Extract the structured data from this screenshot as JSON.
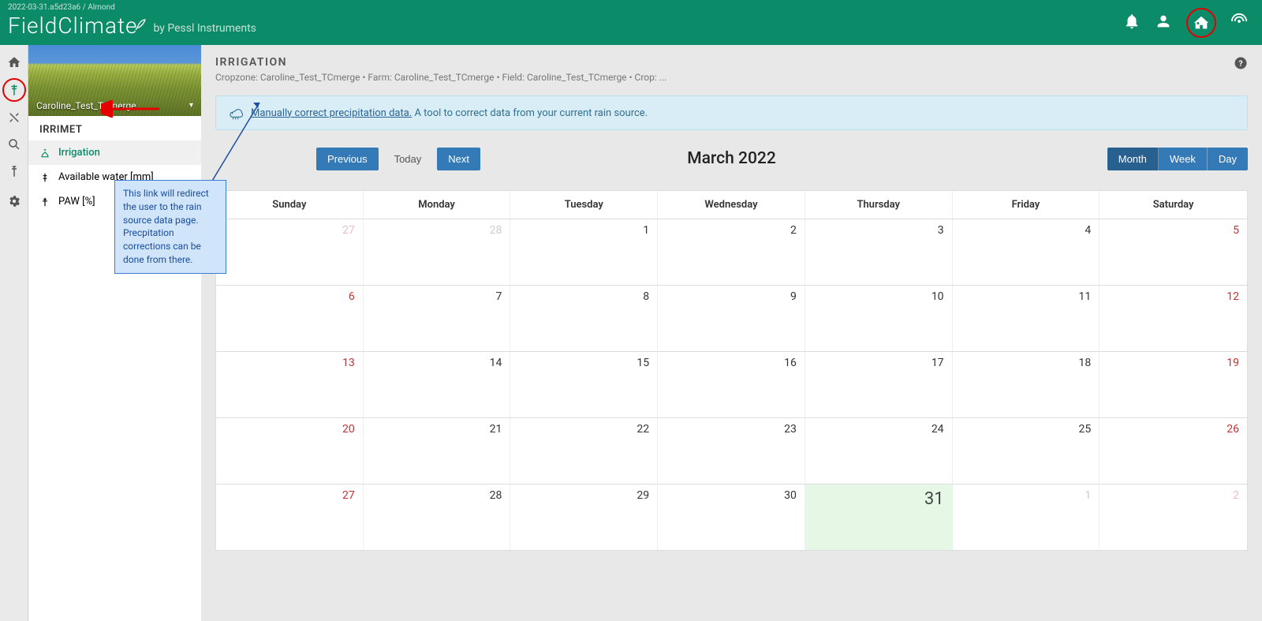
{
  "header": {
    "version": "2022-03-31.a5d23a6 / Almond",
    "logo": "FieldClimate",
    "tagline": "by Pessl Instruments"
  },
  "sidebar": {
    "field_name": "Caroline_Test_TCmerge",
    "section_title": "IRRIMET",
    "items": [
      {
        "label": "Irrigation",
        "icon": "irrigation",
        "active": true
      },
      {
        "label": "Available water [mm]",
        "icon": "water-mm",
        "active": false
      },
      {
        "label": "PAW [%]",
        "icon": "paw",
        "active": false
      }
    ]
  },
  "page": {
    "title": "IRRIGATION",
    "breadcrumb": "Cropzone: Caroline_Test_TCmerge • Farm: Caroline_Test_TCmerge • Field: Caroline_Test_TCmerge • Crop: ..."
  },
  "banner": {
    "link_text": "Manually correct precipitation data.",
    "text": " A tool to correct data from your current rain source."
  },
  "calendar": {
    "nav": {
      "prev": "Previous",
      "today": "Today",
      "next": "Next"
    },
    "views": {
      "month": "Month",
      "week": "Week",
      "day": "Day"
    },
    "title": "March 2022",
    "days": [
      "Sunday",
      "Monday",
      "Tuesday",
      "Wednesday",
      "Thursday",
      "Friday",
      "Saturday"
    ],
    "cells": [
      {
        "n": 27,
        "other": true,
        "we": true
      },
      {
        "n": 28,
        "other": true
      },
      {
        "n": 1
      },
      {
        "n": 2
      },
      {
        "n": 3
      },
      {
        "n": 4
      },
      {
        "n": 5,
        "we": true
      },
      {
        "n": 6,
        "we": true
      },
      {
        "n": 7
      },
      {
        "n": 8
      },
      {
        "n": 9
      },
      {
        "n": 10
      },
      {
        "n": 11
      },
      {
        "n": 12,
        "we": true
      },
      {
        "n": 13,
        "we": true
      },
      {
        "n": 14
      },
      {
        "n": 15
      },
      {
        "n": 16
      },
      {
        "n": 17
      },
      {
        "n": 18
      },
      {
        "n": 19,
        "we": true
      },
      {
        "n": 20,
        "we": true
      },
      {
        "n": 21
      },
      {
        "n": 22
      },
      {
        "n": 23
      },
      {
        "n": 24
      },
      {
        "n": 25
      },
      {
        "n": 26,
        "we": true
      },
      {
        "n": 27,
        "we": true
      },
      {
        "n": 28
      },
      {
        "n": 29
      },
      {
        "n": 30
      },
      {
        "n": 31,
        "today": true
      },
      {
        "n": 1,
        "other": true
      },
      {
        "n": 2,
        "other": true,
        "we": true
      }
    ]
  },
  "callout": {
    "text": "This link will redirect the user to the rain source data page. Precpitation corrections can be done from there."
  }
}
